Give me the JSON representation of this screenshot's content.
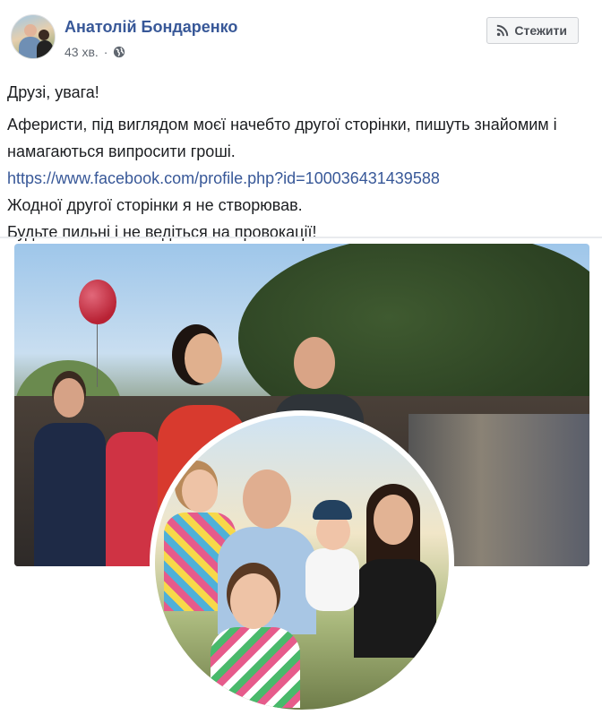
{
  "post": {
    "author": "Анатолій Бондаренко",
    "time": "43 хв.",
    "separator": "·",
    "privacy_icon": "globe-icon",
    "follow_button": {
      "label": "Стежити",
      "icon": "rss-icon"
    }
  },
  "content": {
    "greeting": "Друзі, увага!",
    "line1": "Аферисти, під виглядом моєї начебто другої сторінки, пишуть знайомим і намагаються випросити гроші.",
    "link": "https://www.facebook.com/profile.php?id=100036431439588",
    "line2": "Жодної другої сторінки я не створював.",
    "line3": "Будьте пильні і не ведіться на провокації!"
  },
  "colors": {
    "link": "#385898",
    "text": "#1c1e21",
    "meta": "#606770"
  }
}
